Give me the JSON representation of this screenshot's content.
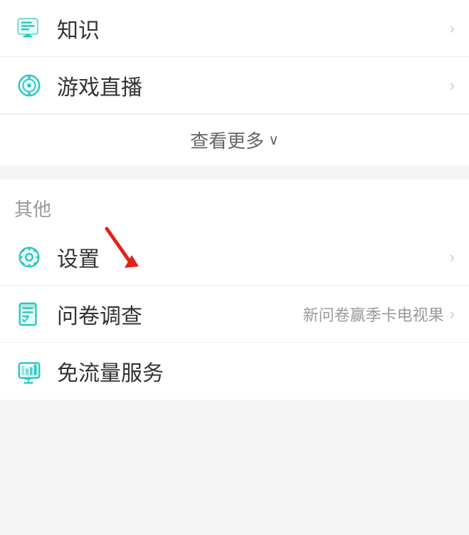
{
  "menu": {
    "items_top": [
      {
        "id": "knowledge",
        "label": "知识",
        "icon": "knowledge",
        "has_chevron": true
      },
      {
        "id": "game-live",
        "label": "游戏直播",
        "icon": "game",
        "has_chevron": true
      }
    ],
    "see_more_label": "查看更多",
    "section_other_title": "其他",
    "items_bottom": [
      {
        "id": "settings",
        "label": "设置",
        "icon": "settings",
        "has_chevron": true,
        "has_arrow": true
      },
      {
        "id": "survey",
        "label": "问卷调查",
        "icon": "survey",
        "badge": "新问卷赢季卡电视果",
        "has_chevron": true
      },
      {
        "id": "free-traffic",
        "label": "免流量服务",
        "icon": "free-traffic",
        "has_chevron": false
      }
    ]
  }
}
